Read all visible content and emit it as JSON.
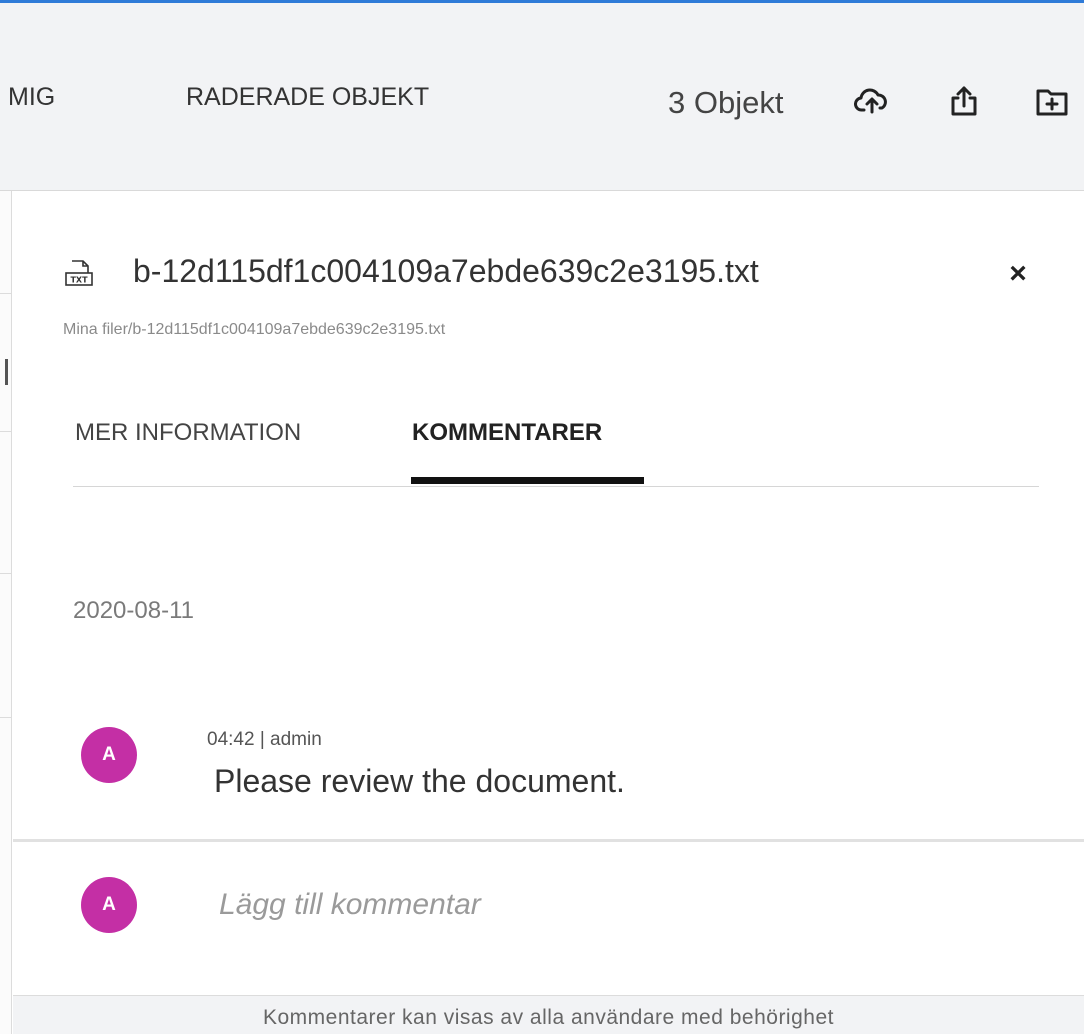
{
  "topbar": {
    "nav_partial": "MIG",
    "nav_deleted": "RADERADE OBJEKT",
    "item_count": "3 Objekt",
    "icons": [
      "cloud-upload-icon",
      "share-upload-icon",
      "new-folder-icon"
    ]
  },
  "details": {
    "file_name": "b-12d115df1c004109a7ebde639c2e3195.txt",
    "file_type_icon": "txt-file-icon",
    "close": "×",
    "path": "Mina filer/b-12d115df1c004109a7ebde639c2e3195.txt",
    "tabs": [
      {
        "label": "MER INFORMATION",
        "active": false
      },
      {
        "label": "KOMMENTARER",
        "active": true
      }
    ]
  },
  "comments": {
    "date": "2020-08-11",
    "items": [
      {
        "avatar": "A",
        "meta": "04:42  |  admin",
        "text": "Please review the document."
      }
    ],
    "new_comment": {
      "avatar": "A",
      "placeholder": "Lägg till kommentar"
    },
    "footer_note": "Kommentarer kan visas av alla användare med behörighet"
  },
  "colors": {
    "accent": "#2f7bd8",
    "avatar": "#c42fa5",
    "topbar_bg": "#f2f3f5"
  }
}
